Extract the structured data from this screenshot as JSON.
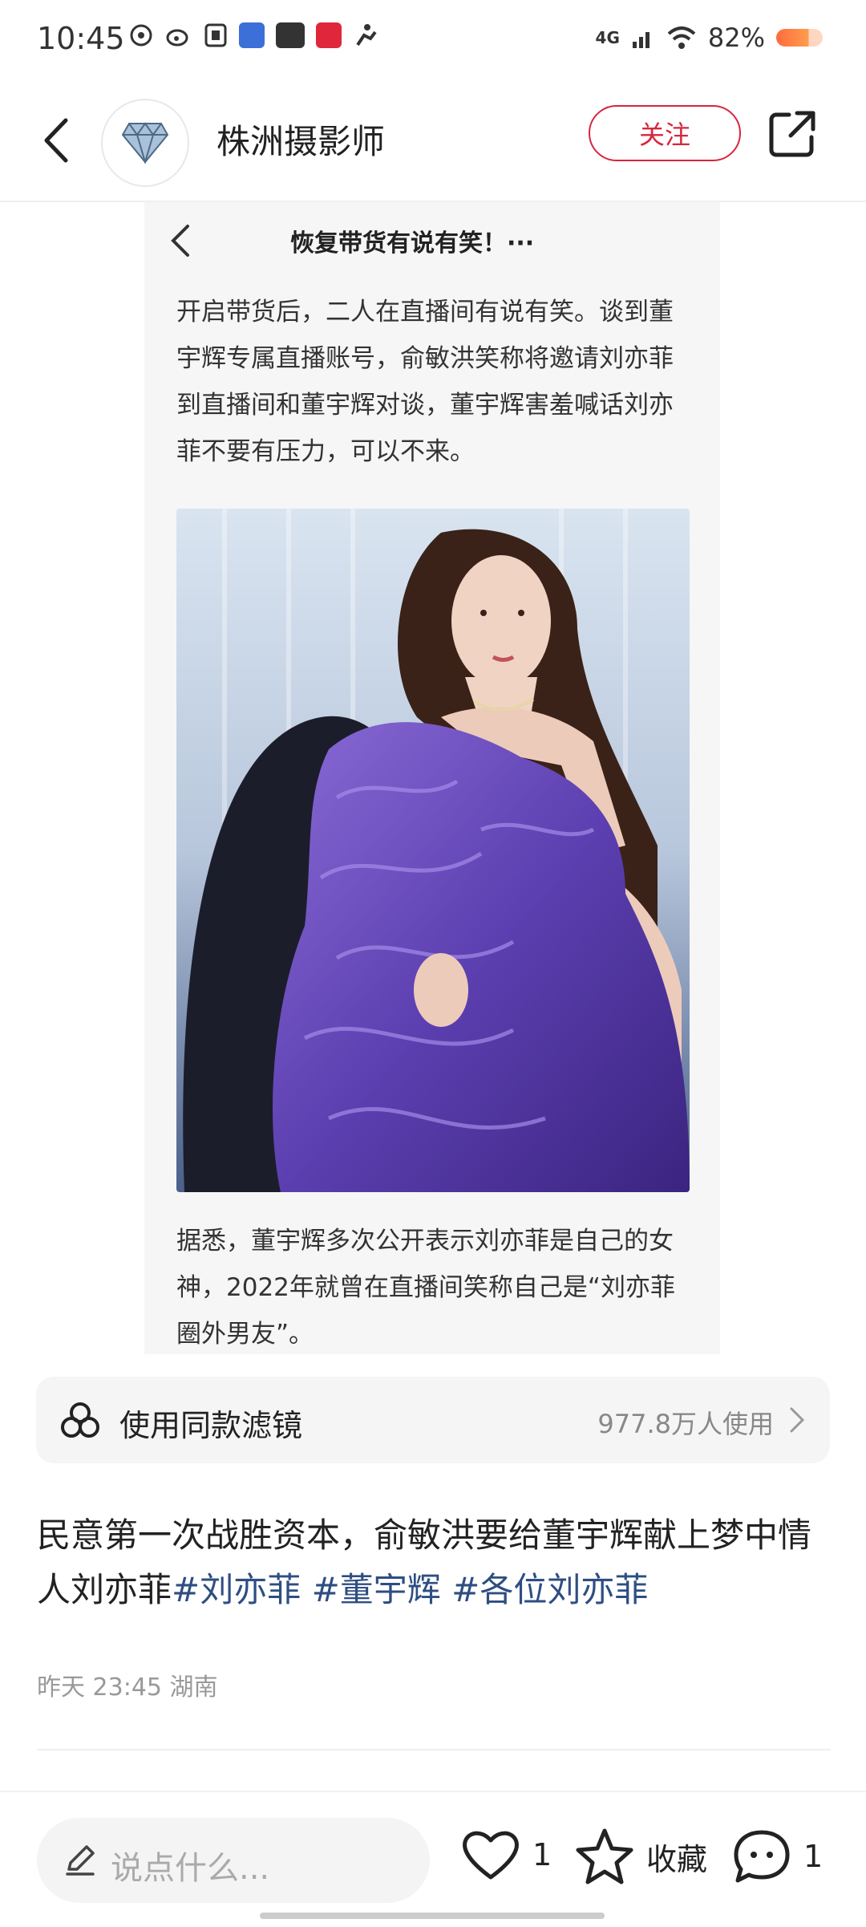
{
  "status_bar": {
    "time": "10:45",
    "network": "4G",
    "battery": "82%",
    "app_icons": [
      "netease-music-icon",
      "weibo-icon",
      "calendar-icon",
      "app-icon",
      "toutiao-icon",
      "huawei-icon",
      "activity-icon"
    ]
  },
  "header": {
    "account_name": "株洲摄影师",
    "follow_label": "关注"
  },
  "embedded_card": {
    "title": "恢复带货有说有笑！···",
    "paragraph1": "开启带货后，二人在直播间有说有笑。谈到董宇辉专属直播账号，俞敏洪笑称将邀请刘亦菲到直播间和董宇辉对谈，董宇辉害羞喊话刘亦菲不要有压力，可以不来。",
    "paragraph2": "据悉，董宇辉多次公开表示刘亦菲是自己的女神，2022年就曾在直播间笑称自己是“刘亦菲圈外男友”。"
  },
  "filter_bar": {
    "label": "使用同款滤镜",
    "usage": "977.8万人使用"
  },
  "post": {
    "text": "民意第一次战胜资本，俞敏洪要给董宇辉献上梦中情人刘亦菲",
    "tags": [
      "#刘亦菲",
      "#董宇辉",
      "#各位刘亦菲"
    ],
    "time": "昨天 23:45",
    "location": "湖南"
  },
  "bottom_bar": {
    "comment_placeholder": "说点什么...",
    "like_count": "1",
    "favorite_label": "收藏",
    "comment_count": "1"
  },
  "colors": {
    "accent": "#d7263d",
    "tag": "#2e4e82"
  }
}
